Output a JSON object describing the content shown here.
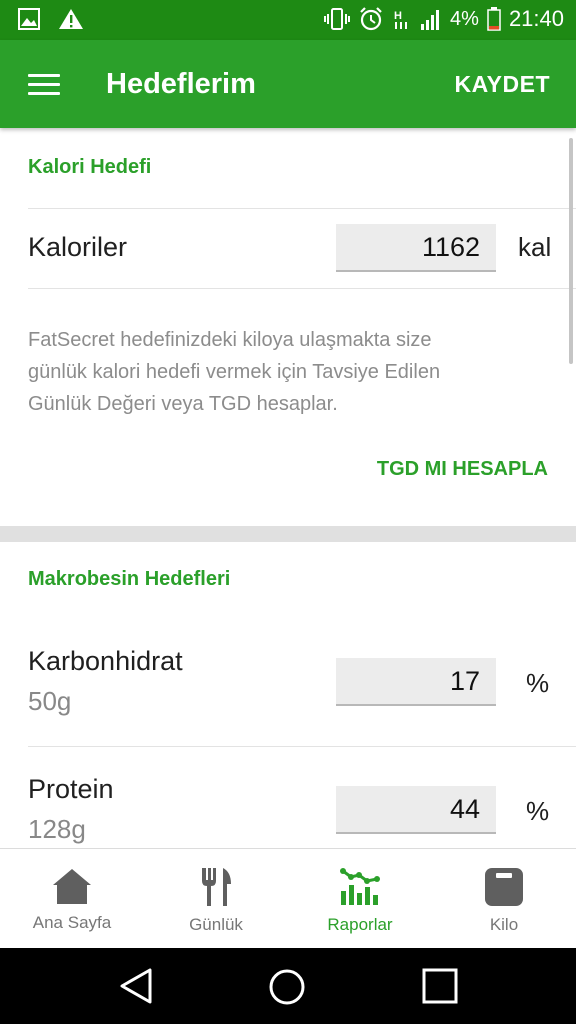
{
  "status_bar": {
    "battery": "4%",
    "time": "21:40"
  },
  "app_bar": {
    "title": "Hedeflerim",
    "save_label": "KAYDET"
  },
  "calorie_section": {
    "title": "Kalori Hedefi",
    "label": "Kaloriler",
    "value": "1162",
    "unit": "kal",
    "description_line1": "FatSecret hedefinizdeki kiloya ulaşmakta size",
    "description_line2": "günlük kalori hedefi vermek için Tavsiye Edilen",
    "description_line3": "Günlük Değeri veya TGD hesaplar.",
    "tgd_button": "TGD MI HESAPLA"
  },
  "macro_section": {
    "title": "Makrobesin Hedefleri",
    "items": [
      {
        "label": "Karbonhidrat",
        "grams": "50g",
        "value": "17",
        "unit": "%"
      },
      {
        "label": "Protein",
        "grams": "128g",
        "value": "44",
        "unit": "%"
      }
    ]
  },
  "bottom_nav": {
    "items": [
      {
        "label": "Ana Sayfa",
        "icon": "home-icon",
        "active": false
      },
      {
        "label": "Günlük",
        "icon": "fork-knife-icon",
        "active": false
      },
      {
        "label": "Raporlar",
        "icon": "chart-icon",
        "active": true
      },
      {
        "label": "Kilo",
        "icon": "scale-icon",
        "active": false
      }
    ]
  },
  "colors": {
    "primary": "#2ba02a",
    "status_bar": "#1e8a14"
  }
}
